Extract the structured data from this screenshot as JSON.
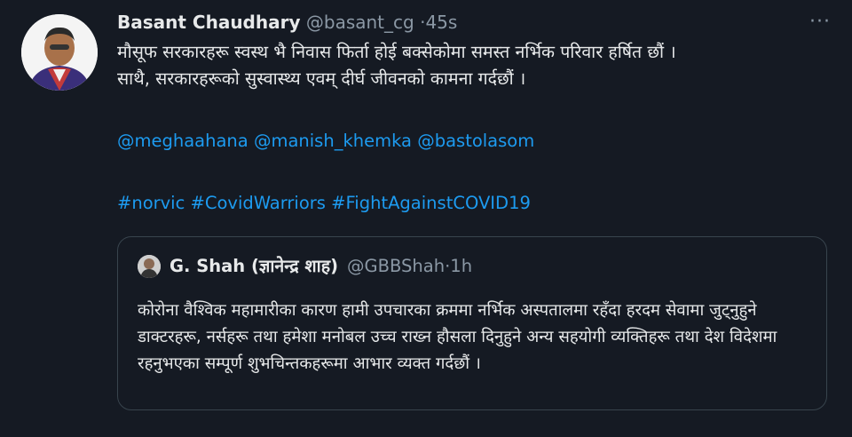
{
  "tweet": {
    "author_name": "Basant Chaudhary",
    "author_handle": "@basant_cg",
    "separator": "·",
    "time": "45s",
    "more_label": "···",
    "line1": "मौसूफ सरकारहरू स्वस्थ भै निवास फिर्ता होई बक्सेकोमा समस्त नर्भिक परिवार हर्षित छौं ।",
    "line2": "साथै, सरकारहरूको सुस्वास्थ्य एवम् दीर्घ जीवनको कामना गर्दछौं ।",
    "mentions": [
      "@meghaahana",
      "@manish_khemka",
      "@bastolasom"
    ],
    "hashtags": [
      "#norvic",
      "#CovidWarriors",
      "#FightAgainstCOVID19"
    ]
  },
  "quote": {
    "author_name": "G. Shah (ज्ञानेन्द्र शाह)",
    "author_handle": "@GBBShah",
    "separator": "·",
    "time": "1h",
    "text": "कोरोना वैश्विक महामारीका कारण हामी उपचारका क्रममा नर्भिक अस्पतालमा रहँदा हरदम सेवामा जुट्नुहुने डाक्टरहरू, नर्सहरू तथा हमेशा मनोबल उच्च राख्न हौसला दिनुहुने अन्य सहयोगी व्यक्तिहरू तथा देश विदेशमा रहनुभएका सम्पूर्ण शुभचिन्तकहरूमा आभार व्यक्त गर्दछौं ।"
  },
  "colors": {
    "background": "#151a23",
    "link": "#1d9bf0",
    "secondary": "#8b98a5",
    "border": "#38444d"
  }
}
